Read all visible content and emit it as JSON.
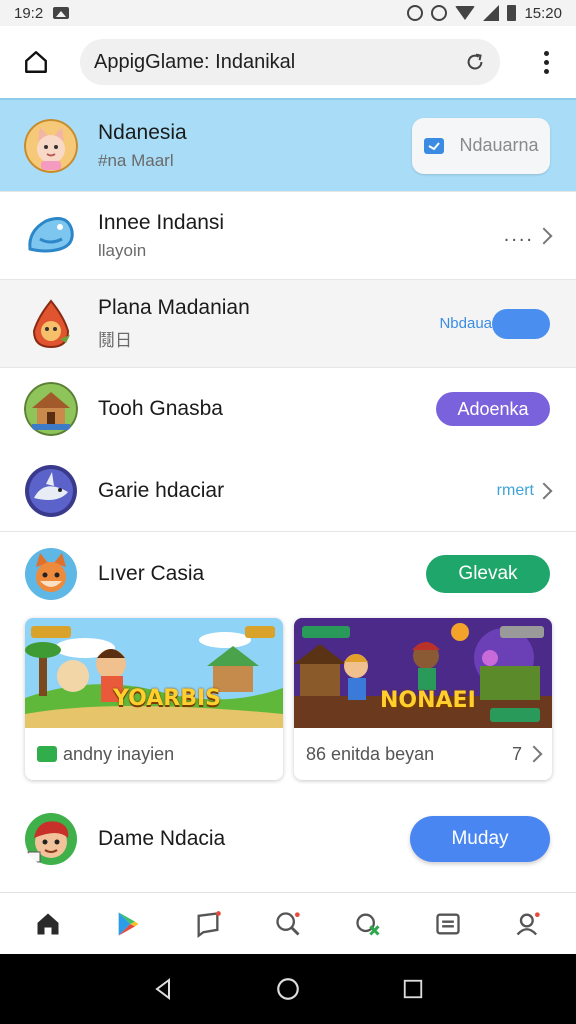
{
  "status_bar": {
    "time_left": "19:2",
    "time_right": "15:20",
    "icons": [
      "image-icon",
      "alarm-icon",
      "alarm-icon",
      "wifi-icon",
      "signal-icon",
      "battery-icon"
    ]
  },
  "browser": {
    "url": "AppigGlame: Indanikal",
    "home_icon": "home-icon",
    "reload_icon": "reload-icon",
    "menu_icon": "more-vert-icon"
  },
  "rows": [
    {
      "title": "Ndanesia",
      "subtitle": "#na Maarl",
      "action": "Ndauarna",
      "action_type": "light-pill",
      "icon": "cat-avatar-icon"
    },
    {
      "title": "Innee Indansi",
      "subtitle": "llayoin",
      "action": "....",
      "action_type": "more",
      "icon": "blue-bird-icon"
    },
    {
      "title": "Plana Madanian",
      "subtitle": "鬩日",
      "action_side": "Nbdaua",
      "action": "",
      "action_type": "blue-pill",
      "icon": "flame-avatar-icon"
    },
    {
      "title": "Tooh Gnasba",
      "subtitle": "",
      "action": "Adoenka",
      "action_type": "purple-pill",
      "icon": "hut-avatar-icon"
    },
    {
      "title": "Garie hdaciar",
      "subtitle": "",
      "action": "rmert",
      "action_type": "link",
      "icon": "shark-avatar-icon"
    },
    {
      "title": "Lıver Casia",
      "subtitle": "",
      "action": "Glevak",
      "action_type": "green-pill",
      "icon": "fox-avatar-icon"
    },
    {
      "title": "Dame Ndacia",
      "subtitle": "",
      "action": "Muday",
      "action_type": "blue-pill-large",
      "icon": "boy-avatar-icon"
    }
  ],
  "cards": [
    {
      "banner_title": "YOARBIS",
      "footer": "andny inayien",
      "icon": "green-badge-icon"
    },
    {
      "banner_title": "NONAEI",
      "footer": "86 enitda beyan",
      "footer_end": "7"
    }
  ],
  "bottom_nav": [
    "home-icon",
    "play-store-icon",
    "chat-icon",
    "search-icon",
    "cancel-search-icon",
    "list-icon",
    "profile-icon"
  ],
  "system_nav": [
    "back-icon",
    "home-circle-icon",
    "recents-icon"
  ],
  "colors": {
    "highlight_row": "#a9ddf7",
    "purple": "#7b62dd",
    "green": "#1fa66a",
    "blue": "#4a86f2"
  }
}
